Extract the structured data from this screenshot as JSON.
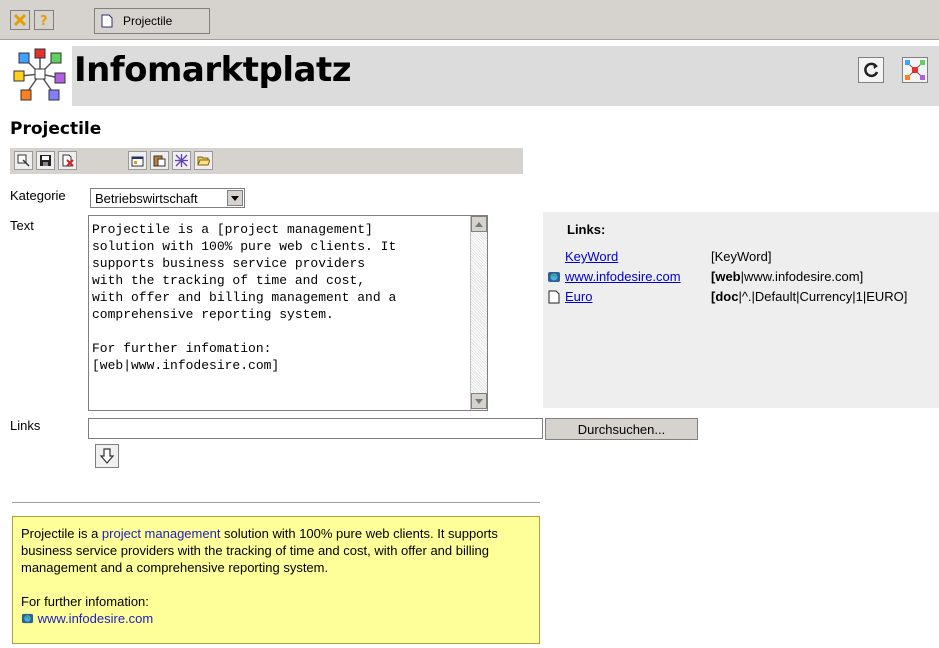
{
  "toolbar": {
    "tab_label": "Projectile",
    "close_icon": "close-x-icon",
    "help_icon": "help-question-icon"
  },
  "header": {
    "app_title": "Infomarktplatz",
    "refresh_icon": "refresh-icon",
    "network_icon": "network-icon"
  },
  "page": {
    "title": "Projectile"
  },
  "actions": [
    {
      "icon": "open-record-icon"
    },
    {
      "icon": "save-icon"
    },
    {
      "icon": "delete-icon"
    },
    {
      "icon": "properties-icon"
    },
    {
      "icon": "paste-icon"
    },
    {
      "icon": "network-icon"
    },
    {
      "icon": "folder-open-icon"
    }
  ],
  "form": {
    "category_label": "Kategorie",
    "category_value": "Betriebswirtschaft",
    "text_label": "Text",
    "text_value": "Projectile is a [project management]\nsolution with 100% pure web clients. It\nsupports business service providers\nwith the tracking of time and cost,\nwith offer and billing management and a\ncomprehensive reporting system.\n\nFor further infomation:\n[web|www.infodesire.com]",
    "links_label": "Links",
    "links_value": "",
    "browse_label": "Durchsuchen..."
  },
  "links_panel": {
    "title": "Links:",
    "items": [
      {
        "icon": "",
        "label": "KeyWord",
        "code_bold": "",
        "code_rest": "[KeyWord]"
      },
      {
        "icon": "web-link-icon",
        "label": "www.infodesire.com",
        "code_bold": "[web",
        "code_rest": "|www.infodesire.com]"
      },
      {
        "icon": "document-icon",
        "label": "Euro",
        "code_bold": "[doc",
        "code_rest": "|^.|Default|Currency|1|EURO]"
      }
    ]
  },
  "preview": {
    "pre": "Projectile is a ",
    "keyword": "project management",
    "post": " solution with 100% pure web clients. It supports business service providers with the tracking of time and cost, with offer and billing management and a comprehensive reporting system.",
    "further": "For further infomation:",
    "link": "www.infodesire.com"
  }
}
